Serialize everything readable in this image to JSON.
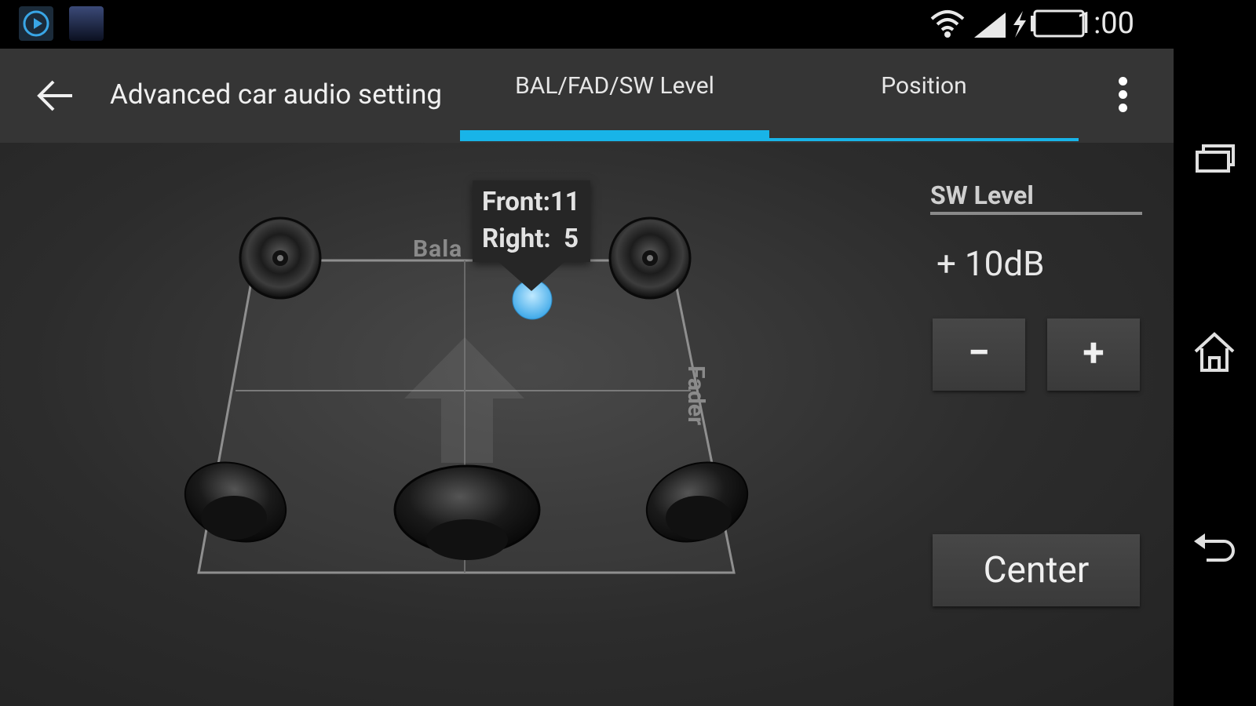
{
  "status_bar": {
    "time": "1:00",
    "notifications": [
      "media-player-icon",
      "video-thumbnail-icon"
    ],
    "icons": [
      "wifi-icon",
      "signal-icon",
      "charging-icon",
      "battery-icon"
    ]
  },
  "action_bar": {
    "title": "Advanced car audio setting",
    "tabs": [
      {
        "label": "BAL/FAD/SW Level",
        "selected": true
      },
      {
        "label": "Position",
        "selected": false
      }
    ],
    "accent_color": "#18b4e8"
  },
  "balance_fader": {
    "axis_labels": {
      "balance": "Bala",
      "fader": "Fader"
    },
    "tooltip": {
      "front": "Front:11",
      "right": "Right:  5"
    }
  },
  "subwoofer": {
    "heading": "SW Level",
    "value": "+ 10dB",
    "minus_label": "−",
    "plus_label": "+"
  },
  "center_label": "Center",
  "nav_bar": [
    "recent-apps-icon",
    "home-icon",
    "back-icon"
  ]
}
